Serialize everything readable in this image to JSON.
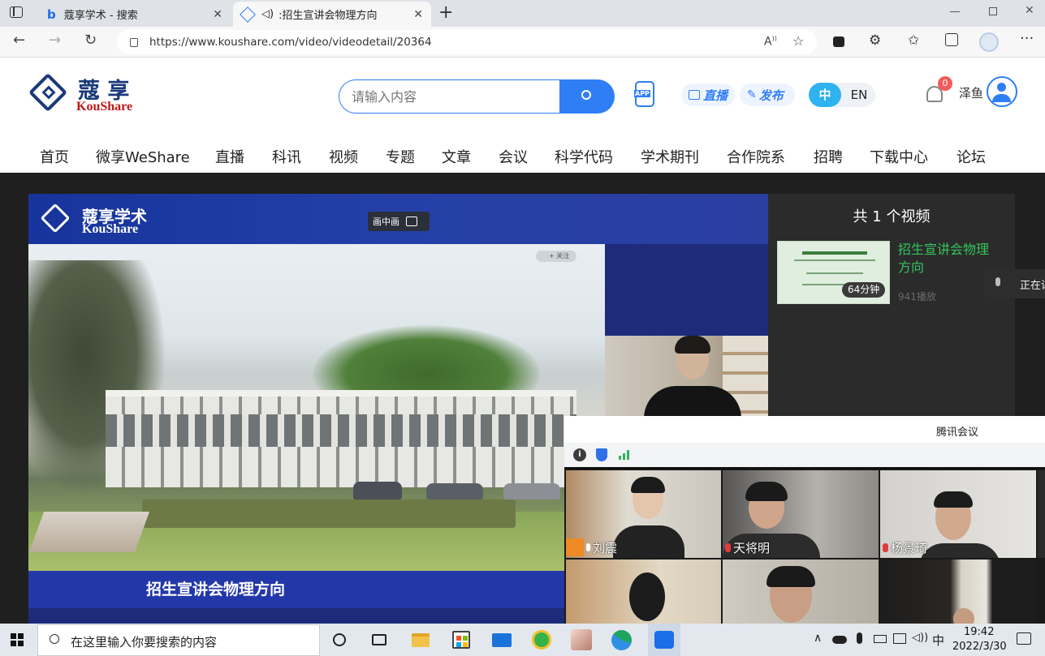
{
  "browser": {
    "tabs": [
      {
        "label": "蔻享学术 - 搜索"
      },
      {
        "label": ":招生宣讲会物理方向"
      }
    ],
    "url": "https://www.koushare.com/video/videodetail/20364"
  },
  "site": {
    "logo_cn": "蔻 享",
    "logo_en": "KouShare",
    "search_placeholder": "请输入内容",
    "app_label": "APP",
    "live_label": "直播",
    "publish_label": "发布",
    "lang_cn": "中",
    "lang_en": "EN",
    "notif_count": "0",
    "username": "泽鱼",
    "menu": [
      "首页",
      "微享WeShare",
      "直播",
      "科讯",
      "视频",
      "专题",
      "文章",
      "会议",
      "科学代码",
      "学术期刊",
      "合作院系",
      "招聘",
      "下载中心",
      "论坛"
    ]
  },
  "player": {
    "brand_cn": "蔻享学术",
    "brand_en": "KouShare",
    "pip_label": "画中画",
    "follow_label": "+ 关注",
    "caption": "招生宣讲会物理方向"
  },
  "playlist": {
    "header": "共 1 个视频",
    "item_title": "招生宣讲会物理方向",
    "duration": "64分钟",
    "plays": "941播放",
    "speaking": "正在讲"
  },
  "meeting": {
    "app_title": "腾讯会议",
    "participants": [
      "刘震",
      "天将明",
      "杨景琦"
    ]
  },
  "taskbar": {
    "search_placeholder": "在这里输入你要搜索的内容",
    "ime": "中",
    "time": "19:42",
    "date": "2022/3/30"
  },
  "colors": {
    "accent": "#2f7ef5",
    "green_title": "#35c35b",
    "notif": "#f25c5c"
  }
}
